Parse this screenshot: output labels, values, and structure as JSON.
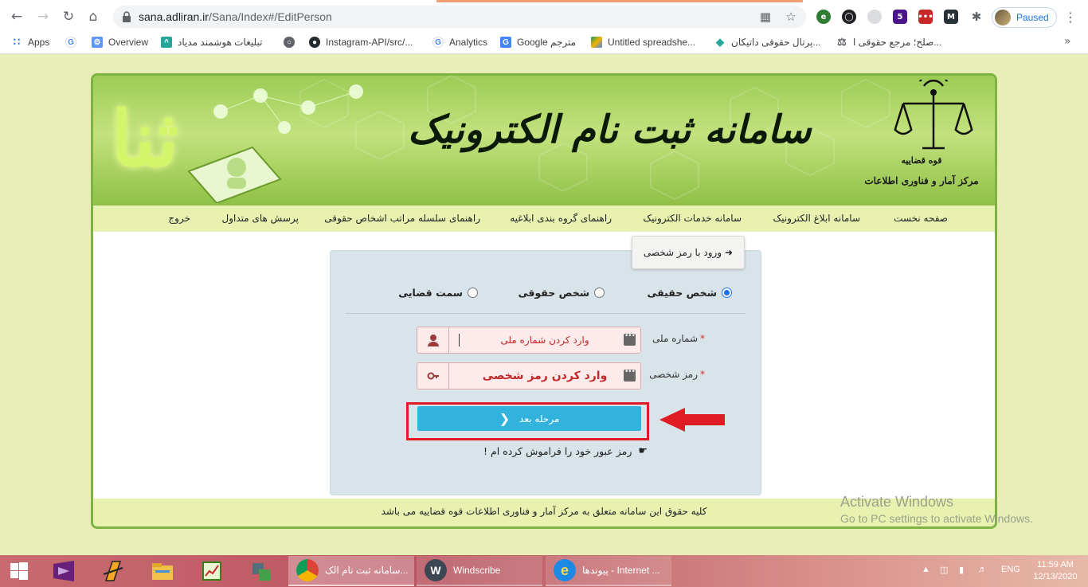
{
  "browser": {
    "url_host": "sana.adliran.ir",
    "url_path": "/Sana/Index#/EditPerson",
    "profile_label": "Paused",
    "bookmarks": [
      {
        "label": "Apps",
        "icon": "apps-grid-icon"
      },
      {
        "label": "",
        "icon": "google-icon"
      },
      {
        "label": "Overview",
        "icon": "overview-icon"
      },
      {
        "label": "تبلیغات هوشمند مدیاد",
        "icon": "mediad-icon"
      },
      {
        "label": "",
        "icon": "globe-icon"
      },
      {
        "label": "Instagram-API/src/...",
        "icon": "github-icon"
      },
      {
        "label": "Analytics",
        "icon": "google-icon"
      },
      {
        "label": "Google مترجم",
        "icon": "translate-icon"
      },
      {
        "label": "Untitled spreadshe...",
        "icon": "drive-icon"
      },
      {
        "label": "پرتال حقوقی داتیکان...",
        "icon": "datikan-icon"
      },
      {
        "label": "صلح؛ مرجع حقوقی ا...",
        "icon": "scales-icon"
      }
    ]
  },
  "header": {
    "banner_title": "سامانه ثبت نام الکترونیک",
    "logo_top": "قوه قضاییه",
    "logo_text": "مرکز آمار و فناوری اطلاعات",
    "left_glyph": "ثنا"
  },
  "nav": {
    "items": [
      "صفحه نخست",
      "سامانه ابلاغ الکترونیک",
      "سامانه خدمات الکترونیک",
      "راهنمای گروه بندی ابلاغیه",
      "راهنمای سلسله مراتب اشخاص حقوقی",
      "پرسش های متداول",
      "خروج"
    ]
  },
  "login": {
    "tab_title": "ورود با رمز شخصی",
    "person_types": [
      {
        "label": "شخص حقیقی",
        "selected": true
      },
      {
        "label": "شخص حقوقی",
        "selected": false
      },
      {
        "label": "سمت قضایی",
        "selected": false
      }
    ],
    "national_id_label": "شماره ملی",
    "national_id_placeholder": "وارد کردن شماره ملی",
    "password_label": "رمز شخصی",
    "password_placeholder": "وارد کردن رمز شخصی",
    "next_button": "مرحله بعد",
    "forgot_link": "رمز عبور خود را فراموش کرده ام !"
  },
  "footer": {
    "copyright": "کلیه حقوق این سامانه متعلق به مرکز آمار و فناوری اطلاعات قوه قضاییه می باشد"
  },
  "watermark": {
    "line1": "Activate Windows",
    "line2": "Go to PC settings to activate Windows."
  },
  "taskbar": {
    "windows": [
      {
        "label": "سامانه ثبت نام الک...",
        "active": true
      },
      {
        "label": "Windscribe",
        "active": false
      },
      {
        "label": "پیوندها - Internet ...",
        "active": false
      }
    ],
    "lang": "ENG",
    "time": "11:59 AM",
    "date": "12/13/2020"
  },
  "colors": {
    "accent_green": "#7cb342",
    "button_blue": "#31b3dd",
    "highlight_red": "#e01b24"
  }
}
